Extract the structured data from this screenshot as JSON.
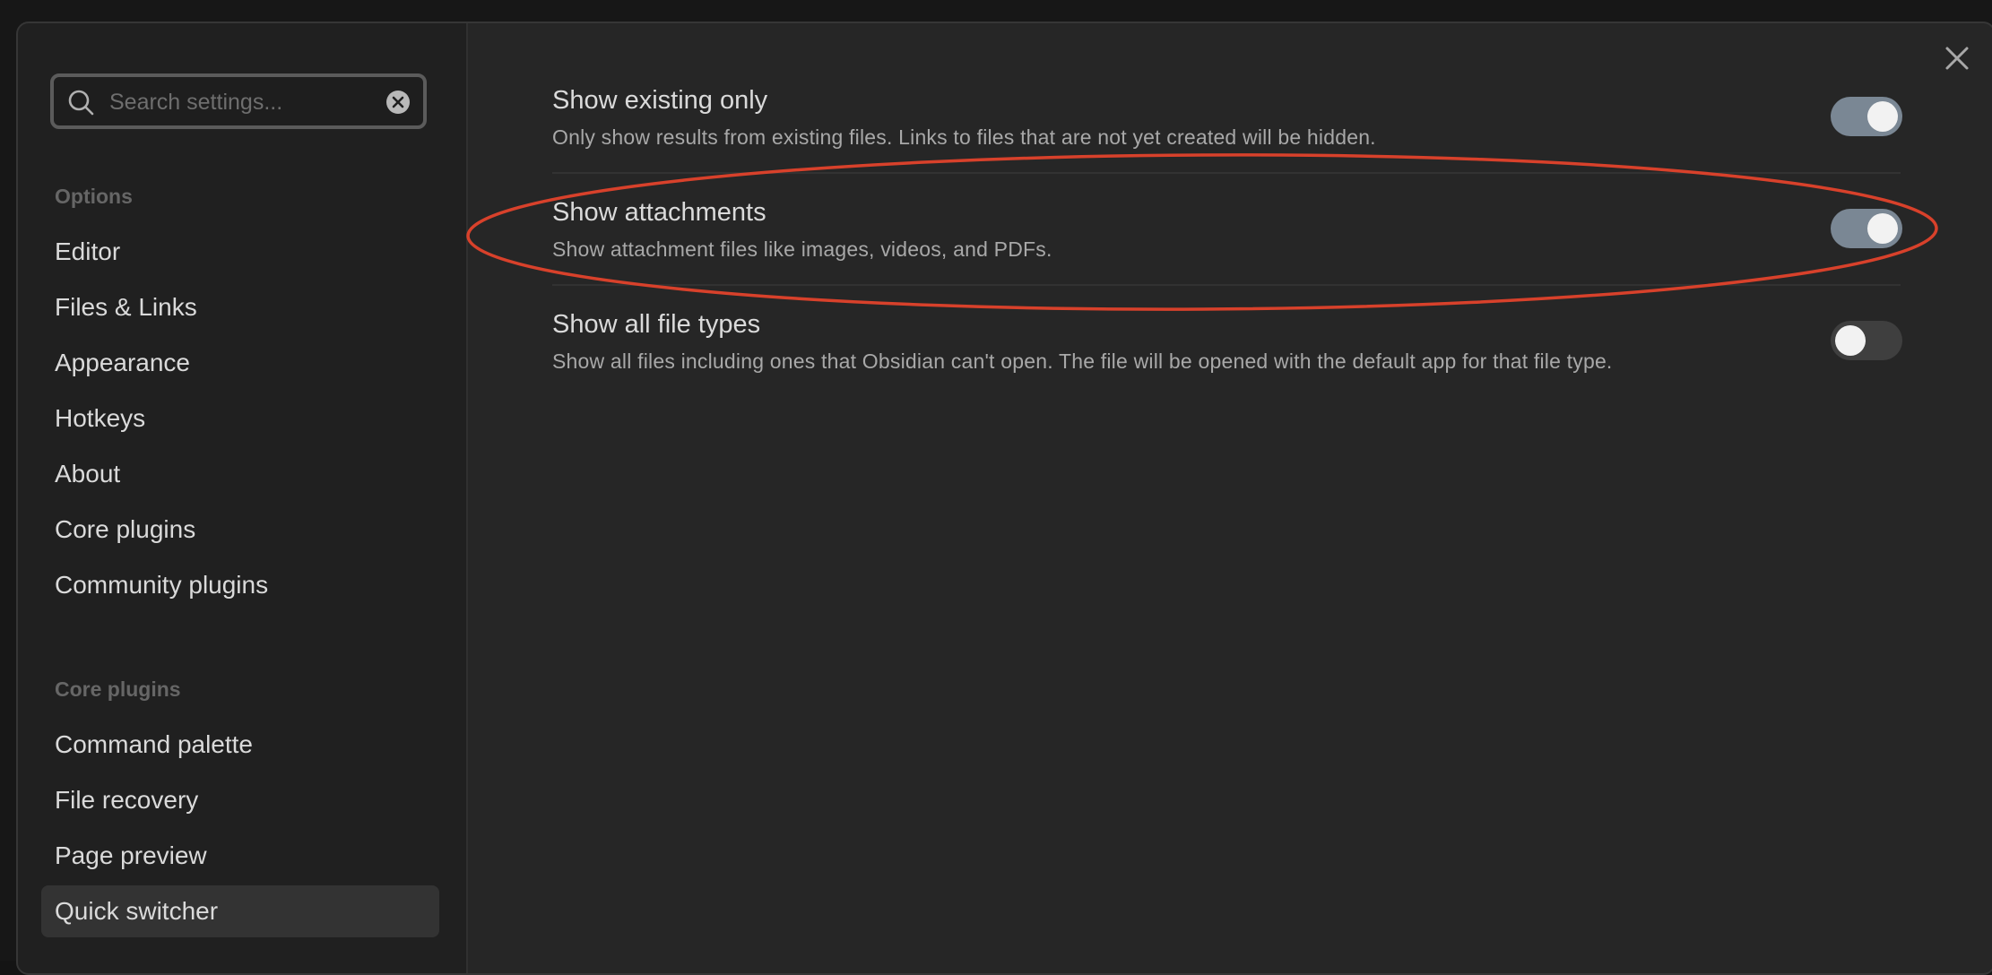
{
  "search": {
    "placeholder": "Search settings..."
  },
  "sidebar": {
    "options_heading": "Options",
    "options": [
      {
        "label": "Editor"
      },
      {
        "label": "Files & Links"
      },
      {
        "label": "Appearance"
      },
      {
        "label": "Hotkeys"
      },
      {
        "label": "About"
      },
      {
        "label": "Core plugins"
      },
      {
        "label": "Community plugins"
      }
    ],
    "core_heading": "Core plugins",
    "core_plugins": [
      {
        "label": "Command palette"
      },
      {
        "label": "File recovery"
      },
      {
        "label": "Page preview"
      },
      {
        "label": "Quick switcher",
        "active": true
      }
    ]
  },
  "settings": [
    {
      "name": "Show existing only",
      "description": "Only show results from existing files. Links to files that are not yet created will be hidden.",
      "enabled": true
    },
    {
      "name": "Show attachments",
      "description": "Show attachment files like images, videos, and PDFs.",
      "enabled": true,
      "highlighted": true
    },
    {
      "name": "Show all file types",
      "description": "Show all files including ones that Obsidian can't open. The file will be opened with the default app for that file type.",
      "enabled": false
    }
  ],
  "colors": {
    "annotation": "#d8412b",
    "toggle_on": "#7a8794",
    "toggle_off": "#3f3f3f"
  }
}
